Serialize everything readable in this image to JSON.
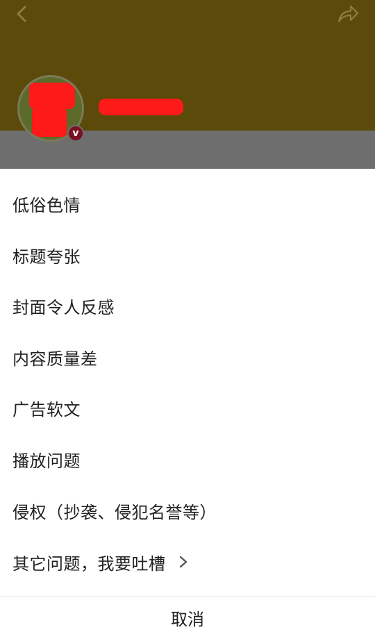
{
  "header": {
    "back_icon": "chevron-left-icon",
    "share_icon": "share-arrow-icon",
    "avatar_icon": "avatar",
    "badge_glyph": "v"
  },
  "report_menu": {
    "items": [
      {
        "label": "低俗色情"
      },
      {
        "label": "标题夸张"
      },
      {
        "label": "封面令人反感"
      },
      {
        "label": "内容质量差"
      },
      {
        "label": "广告软文"
      },
      {
        "label": "播放问题"
      },
      {
        "label": "侵权（抄袭、侵犯名誉等）"
      },
      {
        "label": "其它问题，我要吐槽",
        "has_chevron": true
      }
    ],
    "cancel_label": "取消"
  },
  "colors": {
    "header_bg": "#5c4a0a",
    "overlay_gray": "#6e6e6e",
    "redaction": "#ff1a1a",
    "text": "#222222"
  }
}
